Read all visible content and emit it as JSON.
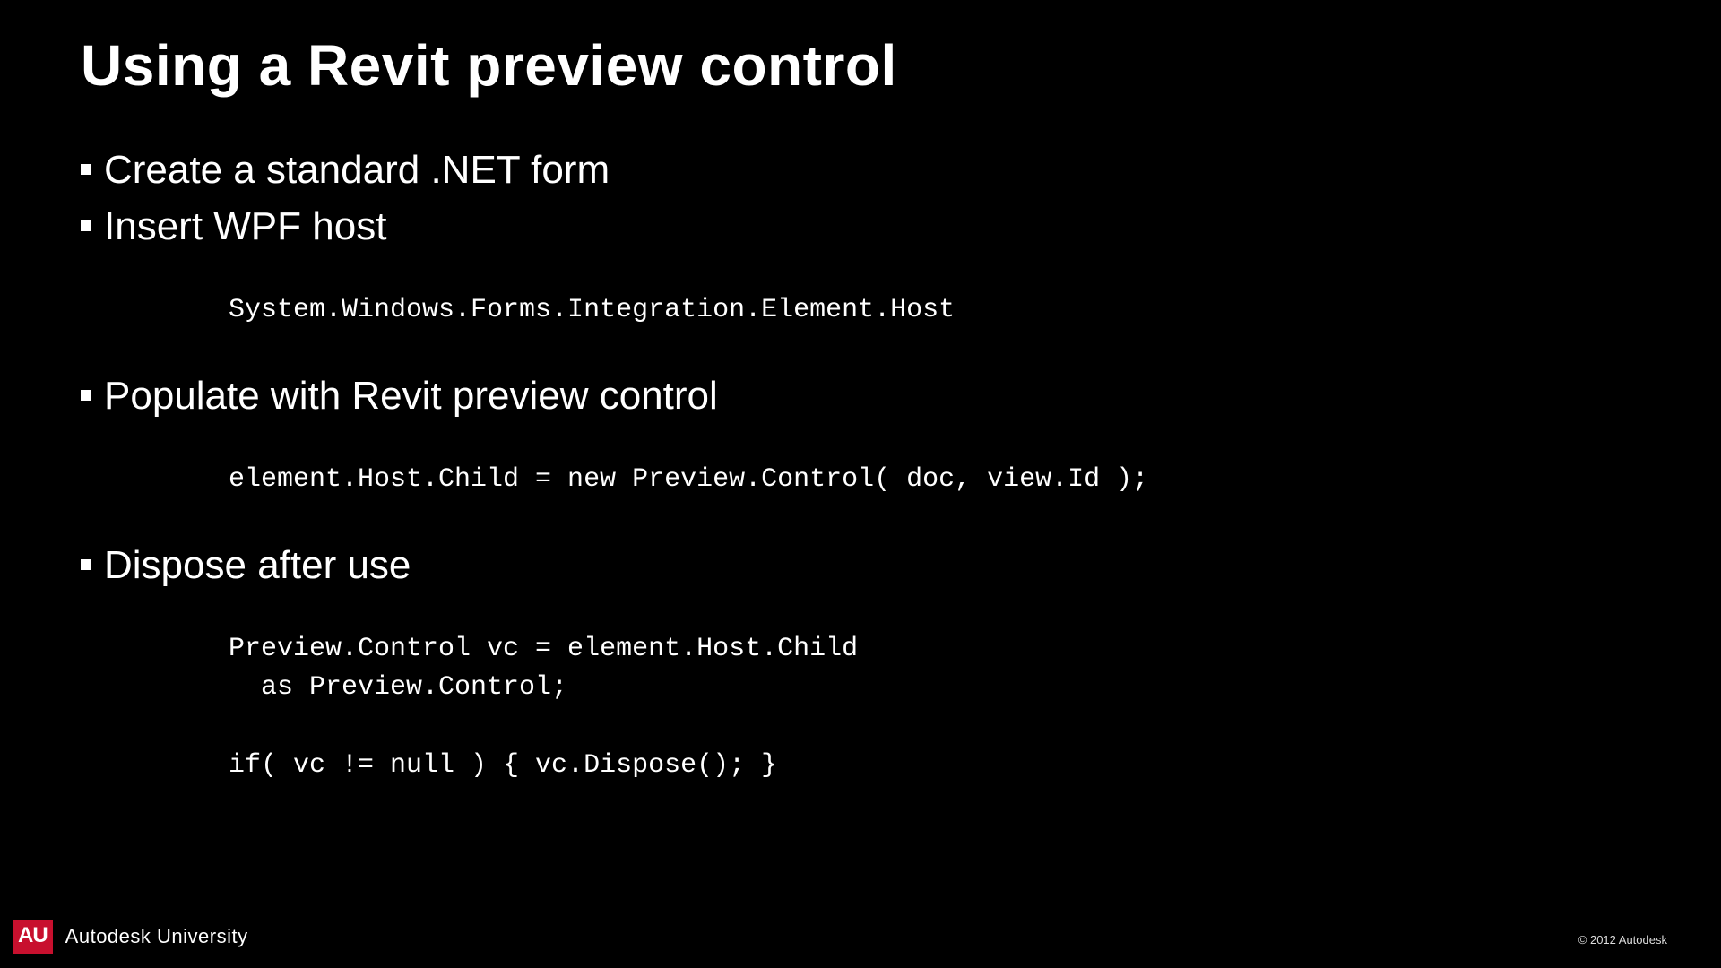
{
  "title": "Using a Revit preview control",
  "bullets": {
    "b1": "Create a standard .NET form",
    "b2": "Insert WPF host",
    "b3": "Populate with Revit preview control",
    "b4": "Dispose after use"
  },
  "code": {
    "c1": "System.Windows.Forms.Integration.Element.Host",
    "c2": "element.Host.Child = new Preview.Control( doc, view.Id );",
    "c3": "Preview.Control vc = element.Host.Child\n  as Preview.Control;\n\nif( vc != null ) { vc.Dispose(); }"
  },
  "footer": {
    "badge": "AU",
    "brand": "Autodesk University",
    "copyright": "© 2012 Autodesk"
  }
}
